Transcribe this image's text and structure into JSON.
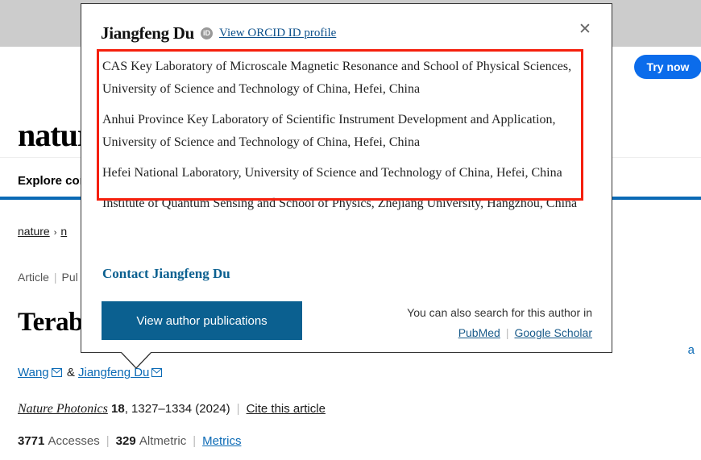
{
  "ad": {
    "text_fragment": ".",
    "cta_label": "Try now"
  },
  "site": {
    "logo": "nature",
    "explore_label": "Explore con"
  },
  "breadcrumb": {
    "items": [
      "nature",
      "n"
    ],
    "separator": "›"
  },
  "article": {
    "type_label": "Article",
    "published_label": "Pul",
    "meta_separator": "|",
    "title": "Terabi",
    "authors_line_end": "a",
    "authors_tail": [
      {
        "name": "Wang",
        "icon": "envelope-icon"
      },
      {
        "name": "Jiangfeng Du",
        "icon": "envelope-icon"
      }
    ],
    "ampersand": "&",
    "journal": "Nature Photonics",
    "volume": "18",
    "pages": ", 1327–1334 (2024)",
    "cite_label": "Cite this article",
    "accesses_count": "3771",
    "accesses_label": "Accesses",
    "altmetric_count": "329",
    "altmetric_label": "Altmetric",
    "metrics_label": "Metrics"
  },
  "popup": {
    "author_name": "Jiangfeng Du",
    "orcid_icon_text": "iD",
    "orcid_link_label": "View ORCID ID profile",
    "close_label": "✕",
    "affiliations": [
      "CAS Key Laboratory of Microscale Magnetic Resonance and School of Physical Sciences, University of Science and Technology of China, Hefei, China",
      "Anhui Province Key Laboratory of Scientific Instrument Development and Application, University of Science and Technology of China, Hefei, China",
      "Hefei National Laboratory, University of Science and Technology of China, Hefei, China",
      "Institute of Quantum Sensing and School of Physics, Zhejiang University, Hangzhou, China"
    ],
    "contact_label": "Contact Jiangfeng Du",
    "view_publications_label": "View author publications",
    "search_also_text": "You can also search for this author in",
    "search_links": [
      "PubMed",
      "Google Scholar"
    ],
    "search_divider": "|"
  },
  "colors": {
    "accent_blue": "#0b6ab5",
    "button_blue": "#0b6090",
    "ad_blue": "#0b6ceb",
    "highlight_red": "#f51f0c",
    "banner_grey": "#cccccc"
  }
}
